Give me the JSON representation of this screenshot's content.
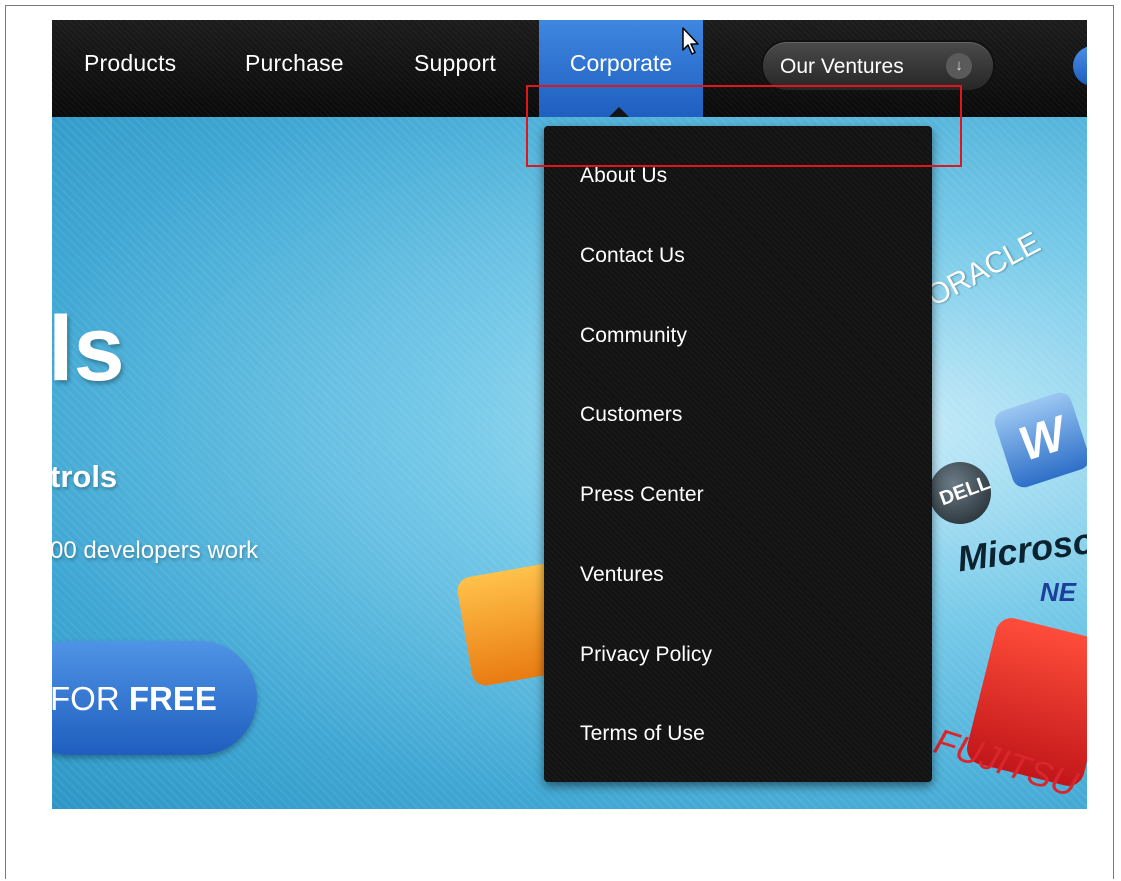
{
  "nav": {
    "items": [
      {
        "label": "Products"
      },
      {
        "label": "Purchase"
      },
      {
        "label": "Support"
      },
      {
        "label": "Corporate",
        "active": true
      }
    ],
    "ventures_label": "Our Ventures",
    "ventures_icon": "arrow-down-icon"
  },
  "hero": {
    "headline_fragment": "ls",
    "subheadline_fragment": "trols",
    "tagline_fragment": "00 developers work",
    "cta_prefix": "FOR",
    "cta_bold": "FREE"
  },
  "logos": {
    "oracle": "ORACLE",
    "microsoft": "Microso",
    "nec": "NE",
    "fujitsu": "FUJITSU",
    "dell": "DELL",
    "word": "W"
  },
  "dropdown": {
    "items": [
      {
        "label": "About Us"
      },
      {
        "label": "Contact Us"
      },
      {
        "label": "Community"
      },
      {
        "label": "Customers"
      },
      {
        "label": "Press Center"
      },
      {
        "label": "Ventures"
      },
      {
        "label": "Privacy Policy"
      },
      {
        "label": "Terms of Use"
      }
    ]
  },
  "colors": {
    "nav_active": "#2f74d4",
    "highlight_box": "#e0161e",
    "dropdown_bg": "#131313"
  }
}
